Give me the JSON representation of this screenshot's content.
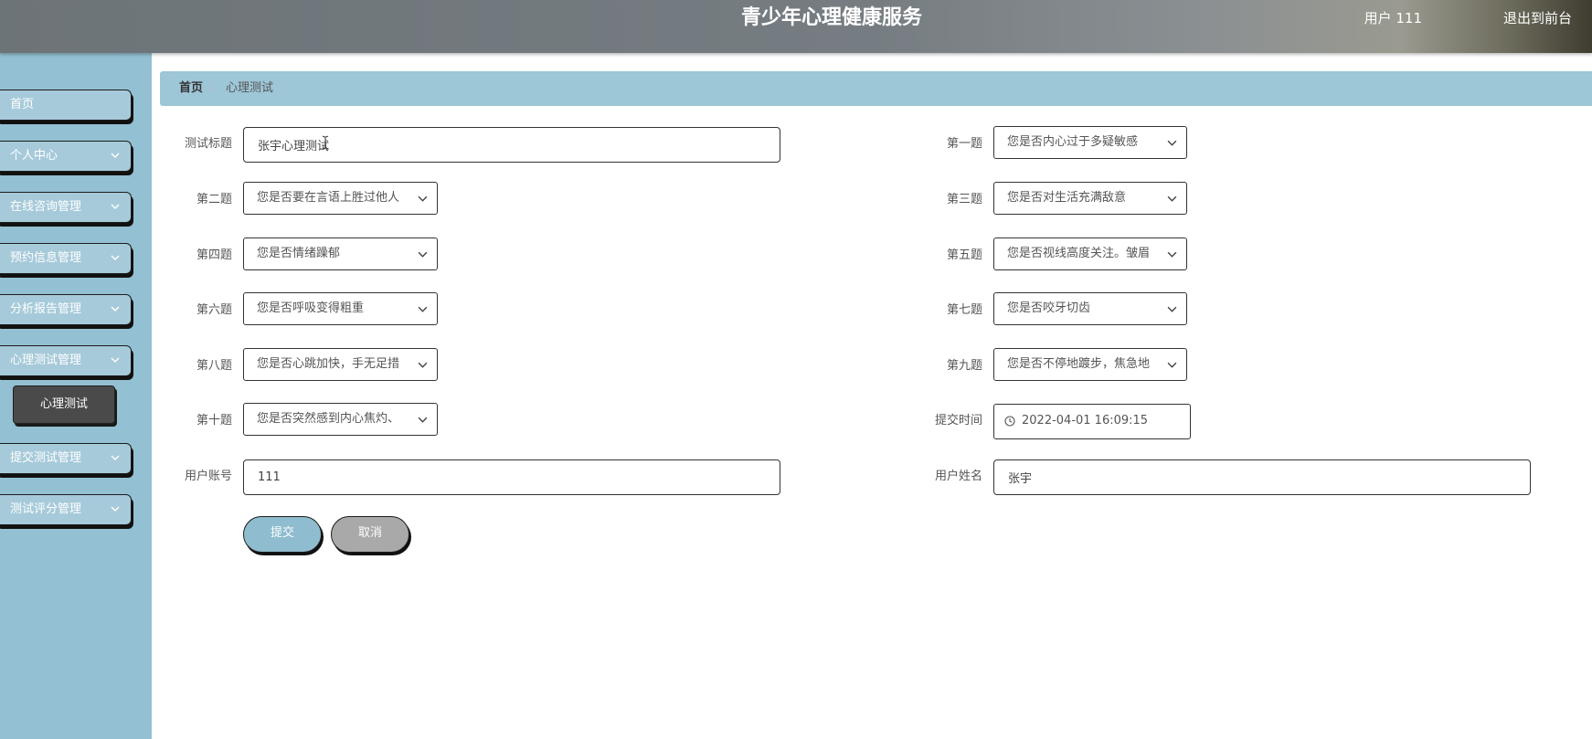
{
  "header": {
    "title": "青少年心理健康服务",
    "user": "用户 111",
    "exit_label": "退出到前台"
  },
  "sidebar": {
    "items": [
      {
        "label": "首页"
      },
      {
        "label": "个人中心"
      },
      {
        "label": "在线咨询管理"
      },
      {
        "label": "预约信息管理"
      },
      {
        "label": "分析报告管理"
      },
      {
        "label": "心理测试管理"
      },
      {
        "label": "提交测试管理"
      },
      {
        "label": "测试评分管理"
      }
    ],
    "active_sub": "心理测试"
  },
  "breadcrumb": {
    "home": "首页",
    "separator": "/",
    "current": "心理测试"
  },
  "form": {
    "title_label": "测试标题",
    "title_value": "张宇心理测试",
    "q1_label": "第一题",
    "q1_value": "您是否内心过于多疑敏感",
    "q2_label": "第二题",
    "q2_value": "您是否要在言语上胜过他人",
    "q3_label": "第三题",
    "q3_value": "您是否对生活充满敌意",
    "q4_label": "第四题",
    "q4_value": "您是否情绪躁郁",
    "q5_label": "第五题",
    "q5_value": "您是否视线高度关注。皱眉",
    "q6_label": "第六题",
    "q6_value": "您是否呼吸变得粗重",
    "q7_label": "第七题",
    "q7_value": "您是否咬牙切齿",
    "q8_label": "第八题",
    "q8_value": "您是否心跳加快，手无足措",
    "q9_label": "第九题",
    "q9_value": "您是否不停地踱步，焦急地",
    "q10_label": "第十题",
    "q10_value": "您是否突然感到内心焦灼、",
    "submit_time_label": "提交时间",
    "submit_time_value": "2022-04-01 16:09:15",
    "account_label": "用户账号",
    "account_value": "111",
    "name_label": "用户姓名",
    "name_value": "张宇",
    "submit_label": "提交",
    "cancel_label": "取消"
  },
  "colors": {
    "sidebar_bg": "#93c0d2",
    "accent": "#8fbccf",
    "header_bg": "#767d82"
  }
}
